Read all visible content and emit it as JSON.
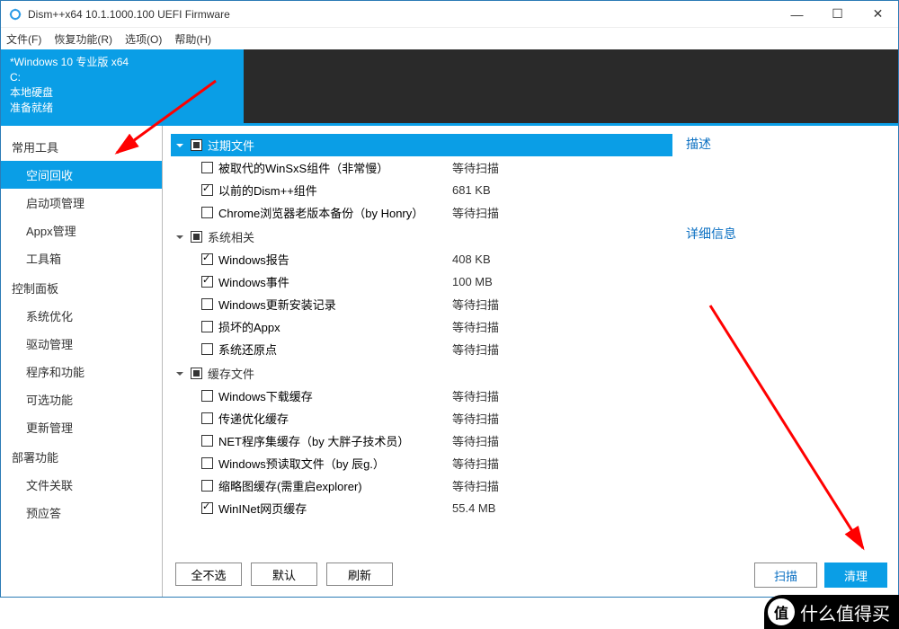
{
  "title": "Dism++x64 10.1.1000.100 UEFI Firmware",
  "menu": {
    "file": "文件(F)",
    "recovery": "恢复功能(R)",
    "options": "选项(O)",
    "help": "帮助(H)"
  },
  "info": {
    "os": "*Windows 10 专业版 x64",
    "drive": "C:",
    "disk": "本地硬盘",
    "status": "准备就绪"
  },
  "sidebar": {
    "g1": {
      "label": "常用工具",
      "items": [
        "空间回收",
        "启动项管理",
        "Appx管理",
        "工具箱"
      ]
    },
    "g2": {
      "label": "控制面板",
      "items": [
        "系统优化",
        "驱动管理",
        "程序和功能",
        "可选功能",
        "更新管理"
      ]
    },
    "g3": {
      "label": "部署功能",
      "items": [
        "文件关联",
        "预应答"
      ]
    }
  },
  "groups": [
    {
      "name": "过期文件",
      "state": "partial",
      "highlight": true,
      "items": [
        {
          "label": "被取代的WinSxS组件（非常慢）",
          "status": "等待扫描",
          "checked": false
        },
        {
          "label": "以前的Dism++组件",
          "status": "681 KB",
          "checked": true
        },
        {
          "label": "Chrome浏览器老版本备份（by Honry）",
          "status": "等待扫描",
          "checked": false
        }
      ]
    },
    {
      "name": "系统相关",
      "state": "partial",
      "highlight": false,
      "items": [
        {
          "label": "Windows报告",
          "status": "408 KB",
          "checked": true
        },
        {
          "label": "Windows事件",
          "status": "100 MB",
          "checked": true
        },
        {
          "label": "Windows更新安装记录",
          "status": "等待扫描",
          "checked": false
        },
        {
          "label": "损坏的Appx",
          "status": "等待扫描",
          "checked": false
        },
        {
          "label": "系统还原点",
          "status": "等待扫描",
          "checked": false
        }
      ]
    },
    {
      "name": "缓存文件",
      "state": "partial",
      "highlight": false,
      "items": [
        {
          "label": "Windows下载缓存",
          "status": "等待扫描",
          "checked": false
        },
        {
          "label": "传递优化缓存",
          "status": "等待扫描",
          "checked": false
        },
        {
          "label": "NET程序集缓存（by 大胖子技术员）",
          "status": "等待扫描",
          "checked": false
        },
        {
          "label": "Windows预读取文件（by 辰g.）",
          "status": "等待扫描",
          "checked": false
        },
        {
          "label": "缩略图缓存(需重启explorer)",
          "status": "等待扫描",
          "checked": false
        },
        {
          "label": "WinINet网页缓存",
          "status": "55.4 MB",
          "checked": true
        }
      ]
    }
  ],
  "buttons": {
    "none": "全不选",
    "default": "默认",
    "refresh": "刷新",
    "scan": "扫描",
    "clean": "清理"
  },
  "right": {
    "desc": "描述",
    "detail": "详细信息"
  },
  "watermark": {
    "char": "值",
    "text": "什么值得买"
  }
}
